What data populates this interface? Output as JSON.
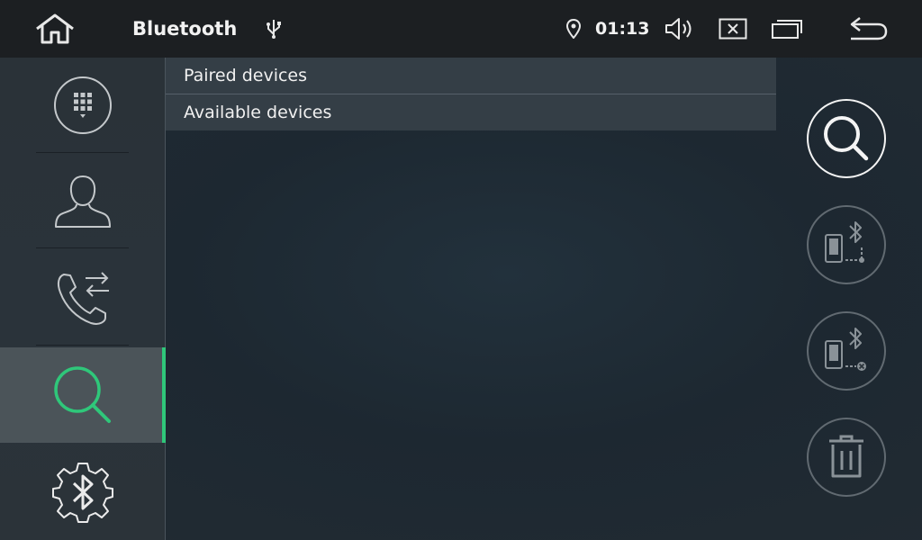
{
  "statusbar": {
    "title": "Bluetooth",
    "time": "01:13",
    "icons": [
      "home-icon",
      "usb-icon",
      "location-icon",
      "volume-icon",
      "close-window-icon",
      "multi-window-icon",
      "back-icon"
    ]
  },
  "sidebar": {
    "items": [
      {
        "name": "dialpad",
        "icon": "dialpad-icon"
      },
      {
        "name": "contacts",
        "icon": "contact-icon"
      },
      {
        "name": "call-log",
        "icon": "call-transfer-icon"
      },
      {
        "name": "search",
        "icon": "search-icon",
        "active": true
      },
      {
        "name": "bt-settings",
        "icon": "bluetooth-settings-icon"
      }
    ]
  },
  "list": {
    "rows": [
      "Paired devices",
      "Available devices"
    ]
  },
  "actions": [
    {
      "name": "search",
      "icon": "search-icon",
      "enabled": true
    },
    {
      "name": "connect",
      "icon": "phone-bluetooth-connect-icon",
      "enabled": false
    },
    {
      "name": "disconnect",
      "icon": "phone-bluetooth-disconnect-icon",
      "enabled": false
    },
    {
      "name": "delete",
      "icon": "trash-icon",
      "enabled": false
    }
  ],
  "colors": {
    "accent": "#2fc77a",
    "statusbar_bg": "#1c1f22",
    "sidebar_bg": "#2a3238",
    "active_bg": "#4b5459"
  }
}
